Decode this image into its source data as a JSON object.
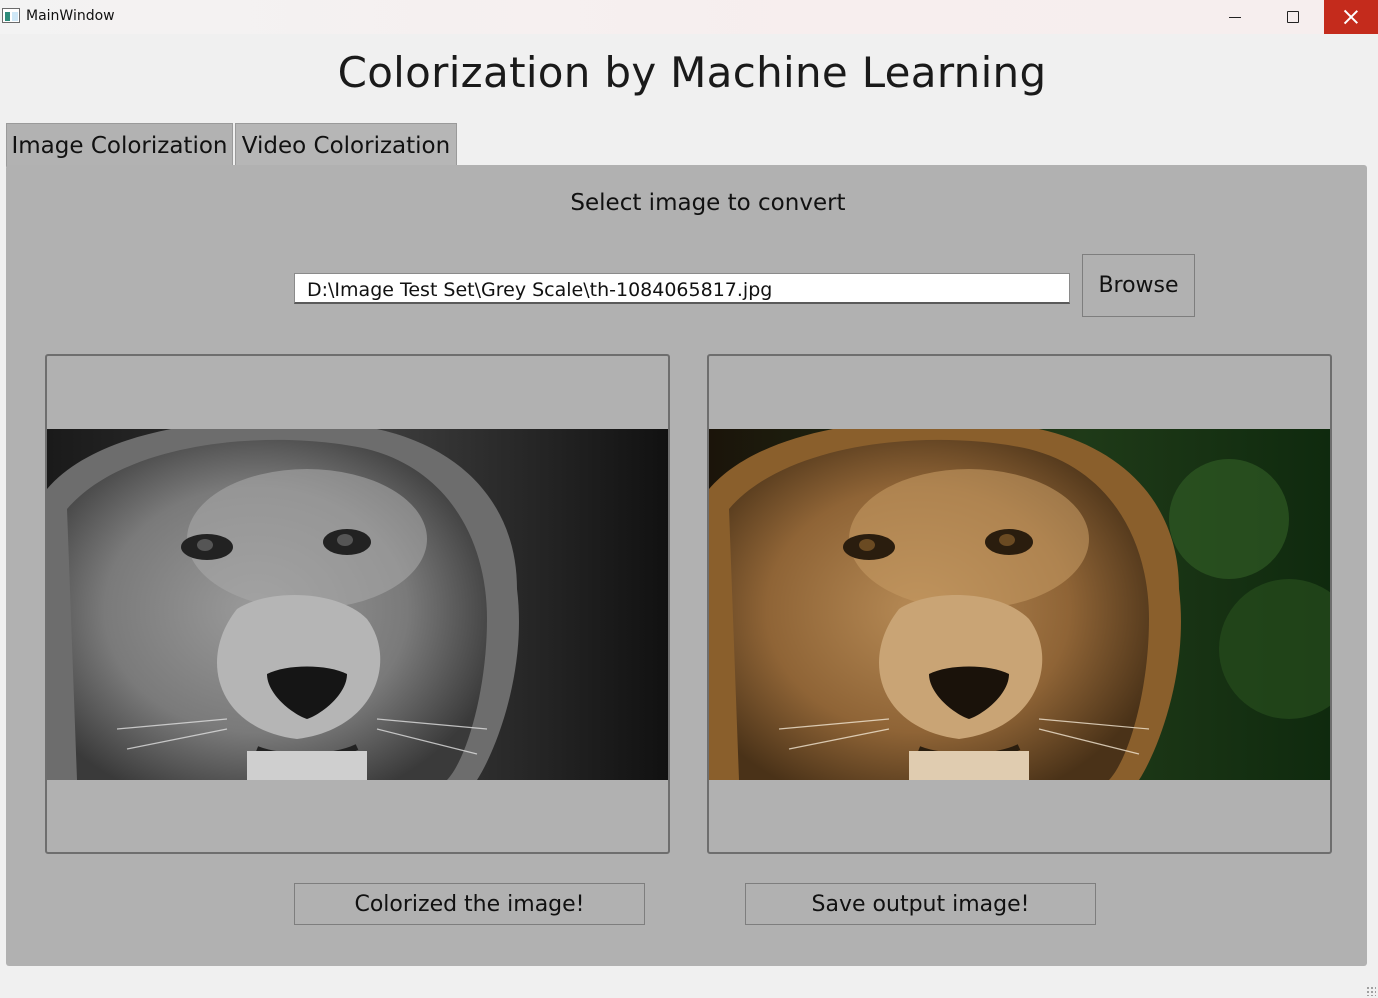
{
  "window": {
    "title": "MainWindow",
    "controls": [
      "minimize-icon",
      "maximize-icon",
      "close-icon"
    ],
    "close_color": "#c42b1c"
  },
  "heading": "Colorization by Machine Learning",
  "tabs": [
    {
      "label": "Image Colorization",
      "selected": true
    },
    {
      "label": "Video Colorization",
      "selected": false
    }
  ],
  "image_tab": {
    "prompt": "Select image to convert",
    "path_value": "D:\\Image Test Set\\Grey Scale\\th-1084065817.jpg",
    "browse_label": "Browse",
    "input_image": {
      "subject": "lion face",
      "style": "grayscale"
    },
    "output_image": {
      "subject": "lion face",
      "style": "colorized"
    },
    "colorize_label": "Colorized the image!",
    "save_label": "Save output image!"
  },
  "colors": {
    "panel": "#b1b1b1",
    "window_bg": "#f0f0f0"
  }
}
